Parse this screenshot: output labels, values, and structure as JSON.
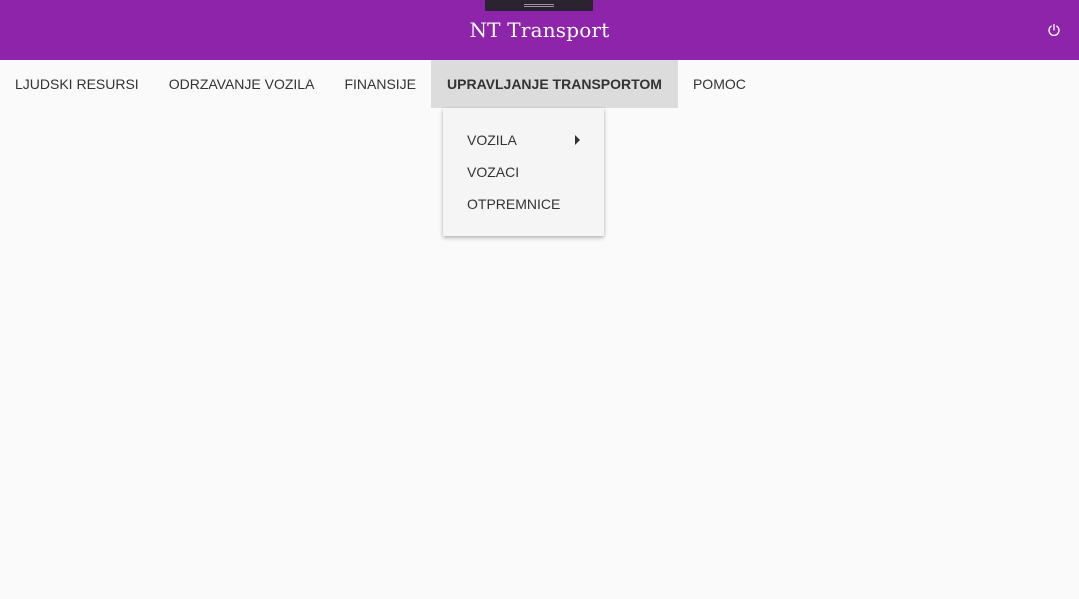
{
  "header": {
    "title": "NT Transport",
    "logout_icon": "power-icon",
    "background_color": "#8e24aa"
  },
  "nav": {
    "items": [
      {
        "label": "LJUDSKI RESURSI"
      },
      {
        "label": "ODRZAVANJE VOZILA"
      },
      {
        "label": "FINANSIJE"
      },
      {
        "label": "UPRAVLJANJE TRANSPORTOM",
        "active": true
      },
      {
        "label": "POMOC"
      }
    ]
  },
  "dropdown": {
    "items": [
      {
        "label": "VOZILA",
        "has_submenu": true,
        "submenu_icon": "caret-right-icon"
      },
      {
        "label": "VOZACI"
      },
      {
        "label": "OTPREMNICE"
      }
    ]
  }
}
